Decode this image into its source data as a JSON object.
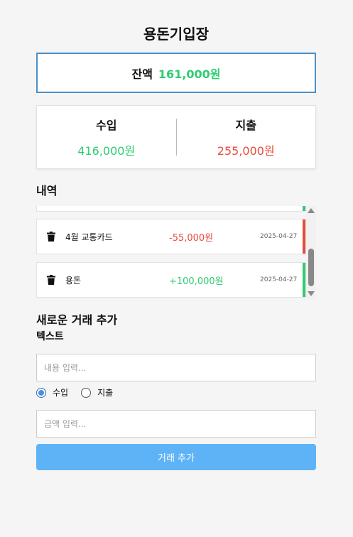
{
  "app": {
    "title": "용돈기입장"
  },
  "balance": {
    "label": "잔액",
    "amount": "161,000원"
  },
  "summary": {
    "income_label": "수입",
    "income_amount": "416,000원",
    "expense_label": "지출",
    "expense_amount": "255,000원"
  },
  "history": {
    "heading": "내역",
    "items": [
      {
        "desc": "4월 교통카드",
        "amount": "-55,000원",
        "date": "2025-04-27",
        "type": "expense"
      },
      {
        "desc": "용돈",
        "amount": "+100,000원",
        "date": "2025-04-27",
        "type": "income"
      }
    ]
  },
  "form": {
    "heading": "새로운 거래 추가",
    "subheading": "텍스트",
    "desc_placeholder": "내용 입력...",
    "radio_income": "수입",
    "radio_expense": "지출",
    "selected": "income",
    "amount_placeholder": "금액 입력...",
    "submit_label": "거래 추가"
  },
  "colors": {
    "income": "#2ecc71",
    "expense": "#e74c3c",
    "accent": "#5eb3f6",
    "border": "#4a90c9"
  }
}
